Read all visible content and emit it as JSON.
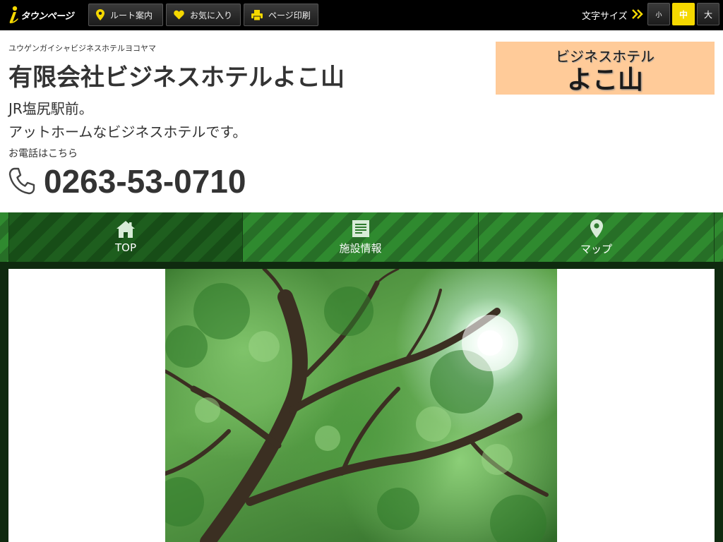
{
  "topbar": {
    "logo_text": "タウンページ",
    "buttons": [
      {
        "label": "ルート案内",
        "icon": "map-pin-icon"
      },
      {
        "label": "お気に入り",
        "icon": "heart-icon"
      },
      {
        "label": "ページ印刷",
        "icon": "printer-icon"
      }
    ],
    "font_size_label": "文字サイズ",
    "font_sizes": [
      {
        "label": "小",
        "active": false
      },
      {
        "label": "中",
        "active": true
      },
      {
        "label": "大",
        "active": false
      }
    ],
    "accent_color": "#f5d800"
  },
  "header": {
    "kana": "ユウゲンガイシャビジネスホテルヨコヤマ",
    "name": "有限会社ビジネスホテルよこ山",
    "tagline_1": "JR塩尻駅前。",
    "tagline_2": "アットホームなビジネスホテルです。",
    "tel_label": "お電話はこちら",
    "phone": "0263-53-0710",
    "logo_line_1": "ビジネスホテル",
    "logo_line_2": "よこ山",
    "logo_bg_color": "#ffcb99"
  },
  "nav": {
    "items": [
      {
        "label": "TOP",
        "icon": "home-icon",
        "active": true
      },
      {
        "label": "施設情報",
        "icon": "document-icon",
        "active": false
      },
      {
        "label": "マップ",
        "icon": "map-pin-icon",
        "active": false
      }
    ],
    "color": "#2f8a2f"
  },
  "main": {
    "hero_image": "tree-canopy-photo"
  }
}
